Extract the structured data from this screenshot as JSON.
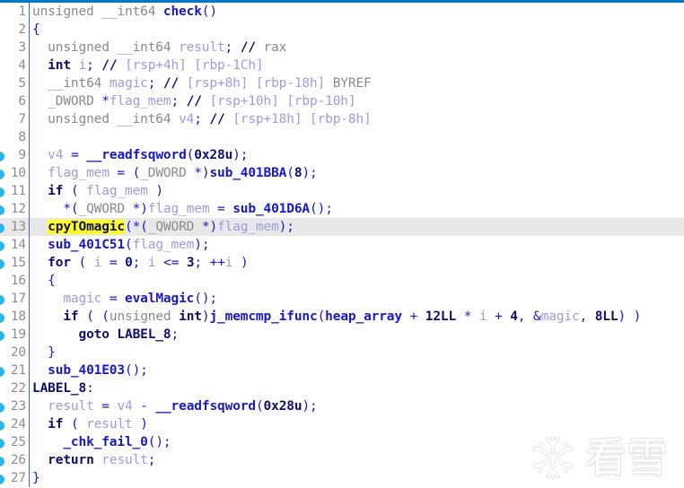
{
  "window": {
    "accent_color": "#0078ce",
    "background_color": "#ffffff",
    "current_line_highlight_color": "#e8e8e8",
    "search_highlight_color": "#ffff1a",
    "breakpoint_dot_color": "#29b6e8",
    "gutter_rule_color": "#3b6ea5"
  },
  "watermark": {
    "icon": "snowflake-icon",
    "text": "看雪"
  },
  "editor": {
    "language": "c-pseudocode",
    "first_line": 1,
    "last_line": 27,
    "current_line": 13,
    "highlighted_token": "cpyTOmagic",
    "lines": [
      {
        "n": "1",
        "dot": false,
        "rule": true,
        "text": "unsigned __int64 check()"
      },
      {
        "n": "2",
        "dot": false,
        "rule": true,
        "text": "{"
      },
      {
        "n": "3",
        "dot": false,
        "rule": true,
        "text": "  unsigned __int64 result; // rax"
      },
      {
        "n": "4",
        "dot": false,
        "rule": true,
        "text": "  int i; // [rsp+4h] [rbp-1Ch]"
      },
      {
        "n": "5",
        "dot": false,
        "rule": true,
        "text": "  __int64 magic; // [rsp+8h] [rbp-18h] BYREF"
      },
      {
        "n": "6",
        "dot": false,
        "rule": true,
        "text": "  _DWORD *flag_mem; // [rsp+10h] [rbp-10h]"
      },
      {
        "n": "7",
        "dot": false,
        "rule": true,
        "text": "  unsigned __int64 v4; // [rsp+18h] [rbp-8h]"
      },
      {
        "n": "8",
        "dot": false,
        "rule": true,
        "text": ""
      },
      {
        "n": "9",
        "dot": true,
        "rule": true,
        "text": "  v4 = __readfsqword(0x28u);"
      },
      {
        "n": "10",
        "dot": true,
        "rule": true,
        "text": "  flag_mem = (_DWORD *)sub_401BBA(8);"
      },
      {
        "n": "11",
        "dot": true,
        "rule": true,
        "text": "  if ( flag_mem )"
      },
      {
        "n": "12",
        "dot": true,
        "rule": true,
        "text": "    *(_QWORD *)flag_mem = sub_401D6A();"
      },
      {
        "n": "13",
        "dot": true,
        "rule": true,
        "text": "  cpyTOmagic(*(_QWORD *)flag_mem);"
      },
      {
        "n": "14",
        "dot": true,
        "rule": true,
        "text": "  sub_401C51(flag_mem);"
      },
      {
        "n": "15",
        "dot": true,
        "rule": true,
        "text": "  for ( i = 0; i <= 3; ++i )"
      },
      {
        "n": "16",
        "dot": false,
        "rule": true,
        "text": "  {"
      },
      {
        "n": "17",
        "dot": true,
        "rule": true,
        "text": "    magic = evalMagic();"
      },
      {
        "n": "18",
        "dot": true,
        "rule": true,
        "text": "    if ( (unsigned int)j_memcmp_ifunc(heap_array + 12LL * i + 4, &magic, 8LL) )"
      },
      {
        "n": "19",
        "dot": true,
        "rule": true,
        "text": "      goto LABEL_8;"
      },
      {
        "n": "20",
        "dot": false,
        "rule": true,
        "text": "  }"
      },
      {
        "n": "21",
        "dot": true,
        "rule": true,
        "text": "  sub_401E03();"
      },
      {
        "n": "22",
        "dot": false,
        "rule": true,
        "text": "LABEL_8:"
      },
      {
        "n": "23",
        "dot": true,
        "rule": true,
        "text": "  result = v4 - __readfsqword(0x28u);"
      },
      {
        "n": "24",
        "dot": true,
        "rule": true,
        "text": "  if ( result )"
      },
      {
        "n": "25",
        "dot": true,
        "rule": true,
        "text": "    _chk_fail_0();"
      },
      {
        "n": "26",
        "dot": true,
        "rule": true,
        "text": "  return result;"
      },
      {
        "n": "27",
        "dot": true,
        "rule": true,
        "text": "}"
      }
    ]
  }
}
